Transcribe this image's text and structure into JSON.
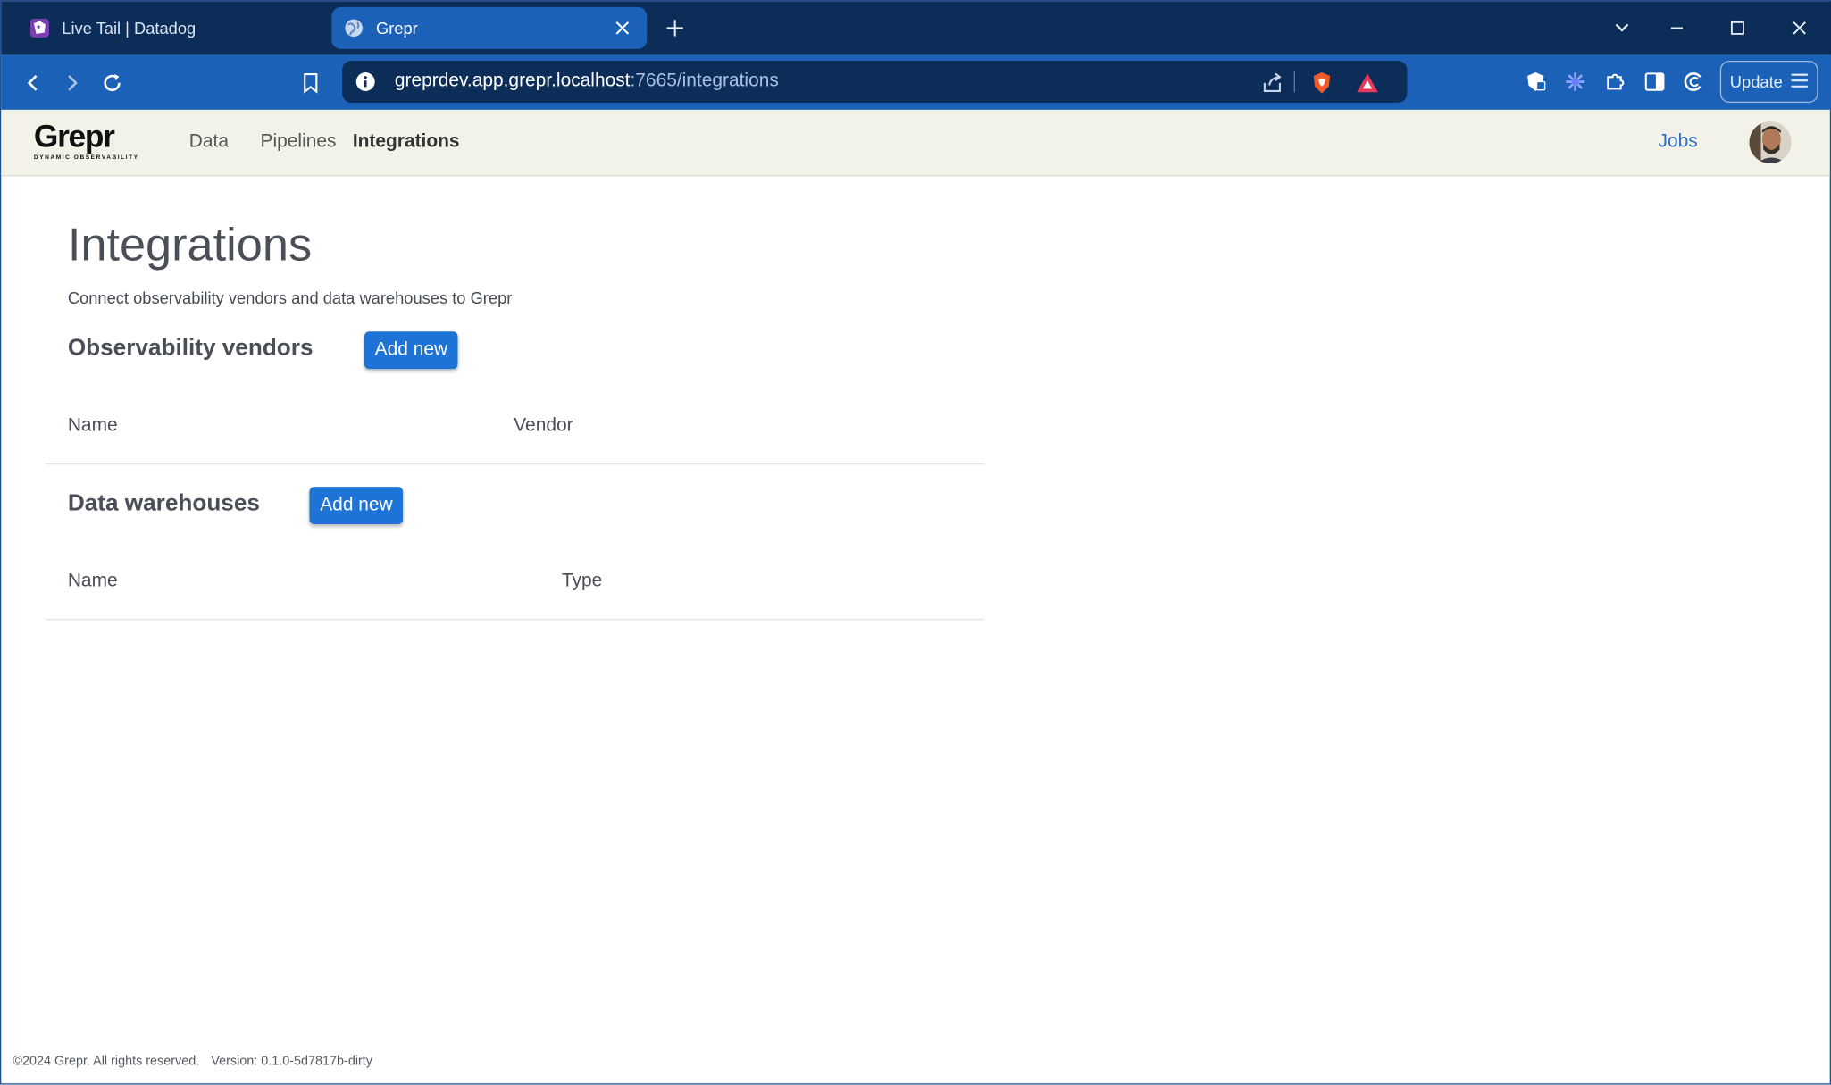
{
  "browser": {
    "tabs": [
      {
        "title": "Live Tail | Datadog",
        "active": false
      },
      {
        "title": "Grepr",
        "active": true
      }
    ],
    "url_host": "greprdev.app.grepr.localhost",
    "url_rest": ":7665/integrations",
    "update_label": "Update"
  },
  "app": {
    "logo_text": "Grepr",
    "logo_tagline": "DYNAMIC OBSERVABILITY",
    "nav": [
      {
        "label": "Data"
      },
      {
        "label": "Pipelines"
      },
      {
        "label": "Integrations",
        "active": true
      }
    ],
    "jobs_label": "Jobs"
  },
  "main": {
    "title": "Integrations",
    "subtitle": "Connect observability vendors and data warehouses to Grepr",
    "vendors": {
      "heading": "Observability vendors",
      "add_label": "Add new",
      "columns": [
        "Name",
        "Vendor"
      ],
      "rows": []
    },
    "warehouses": {
      "heading": "Data warehouses",
      "add_label": "Add new",
      "columns": [
        "Name",
        "Type"
      ],
      "rows": []
    }
  },
  "footer": {
    "copyright": "©2024 Grepr. All rights reserved.",
    "version": "Version: 0.1.0-5d7817b-dirty"
  },
  "colors": {
    "accent": "#1e73d6",
    "browser_frame": "#0c2d57",
    "browser_toolbar": "#1c61b8",
    "app_header": "#f2f2e8",
    "link": "#2e6fc6"
  }
}
